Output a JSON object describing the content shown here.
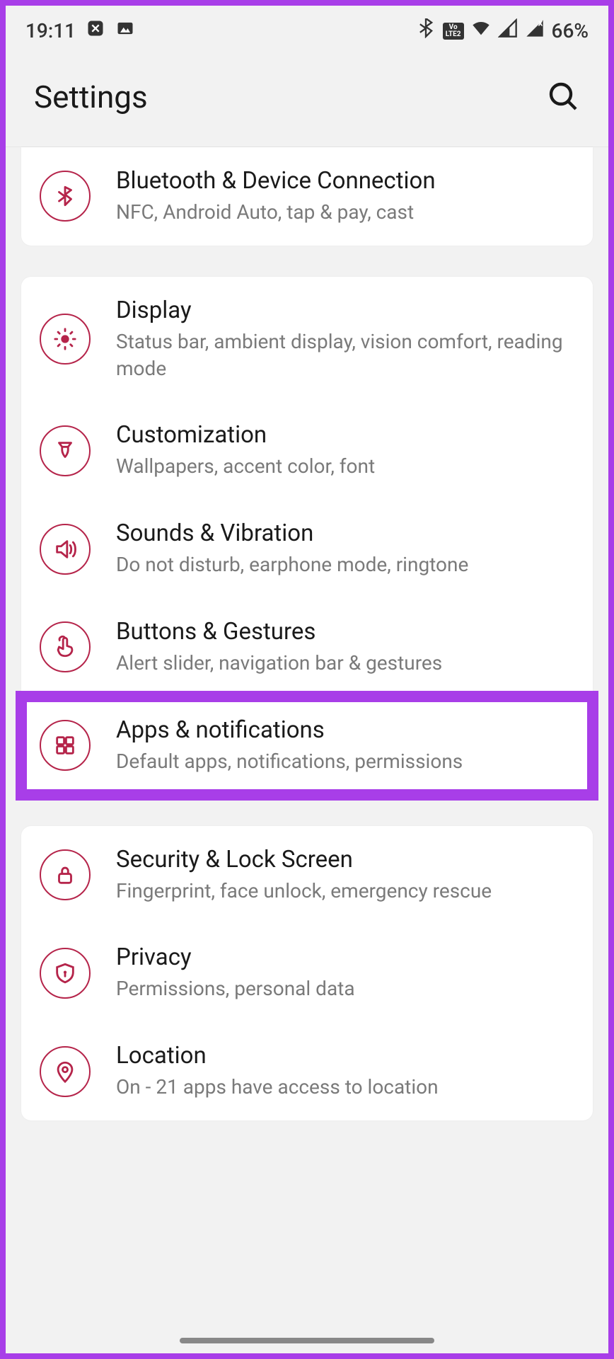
{
  "statusbar": {
    "time": "19:11",
    "battery": "66%"
  },
  "header": {
    "title": "Settings"
  },
  "sections": [
    {
      "items": [
        {
          "title": "Bluetooth & Device Connection",
          "sub": "NFC, Android Auto, tap & pay, cast"
        }
      ]
    },
    {
      "items": [
        {
          "title": "Display",
          "sub": "Status bar, ambient display, vision comfort, reading mode"
        },
        {
          "title": "Customization",
          "sub": "Wallpapers, accent color, font"
        },
        {
          "title": "Sounds & Vibration",
          "sub": "Do not disturb, earphone mode, ringtone"
        },
        {
          "title": "Buttons & Gestures",
          "sub": "Alert slider, navigation bar & gestures"
        },
        {
          "title": "Apps & notifications",
          "sub": "Default apps, notifications, permissions"
        }
      ]
    },
    {
      "items": [
        {
          "title": "Security & Lock Screen",
          "sub": "Fingerprint, face unlock, emergency rescue"
        },
        {
          "title": "Privacy",
          "sub": "Permissions, personal data"
        },
        {
          "title": "Location",
          "sub": "On - 21 apps have access to location"
        }
      ]
    }
  ]
}
